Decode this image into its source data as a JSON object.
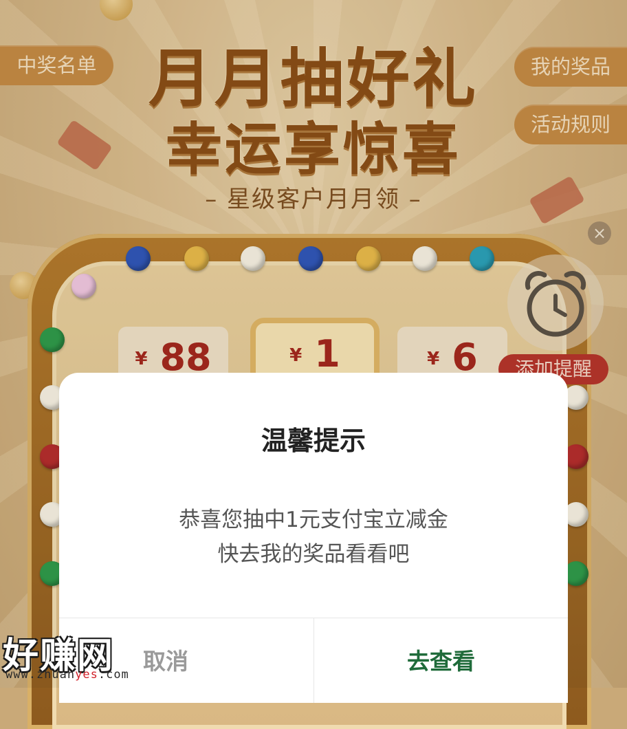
{
  "background": {
    "winners_list_label": "中奖名单",
    "my_prizes_label": "我的奖品",
    "rules_label": "活动规则",
    "title_line1": "月月抽好礼",
    "title_line2": "幸运享惊喜",
    "subtitle": "– 星级客户月月领 –",
    "prizes": [
      {
        "currency": "¥",
        "amount": "88"
      },
      {
        "currency": "¥",
        "amount": "1"
      },
      {
        "currency": "¥",
        "amount": "6"
      }
    ],
    "close_glyph": "×",
    "reminder_label": "添加提醒"
  },
  "dialog": {
    "title": "温馨提示",
    "message_line1": "恭喜您抽中1元支付宝立减金",
    "message_line2": "快去我的奖品看看吧",
    "cancel_label": "取消",
    "confirm_label": "去查看"
  },
  "watermark": {
    "text": "好赚网",
    "url_prefix": "www.zhuan",
    "url_highlight": "yes",
    "url_suffix": ".com"
  },
  "colors": {
    "accent_green": "#1f6b3a",
    "prize_red": "#a3271c",
    "pill_orange": "#c48a43",
    "reminder_red": "#b5342a"
  },
  "icons": [
    "close-icon",
    "alarm-clock-icon"
  ]
}
